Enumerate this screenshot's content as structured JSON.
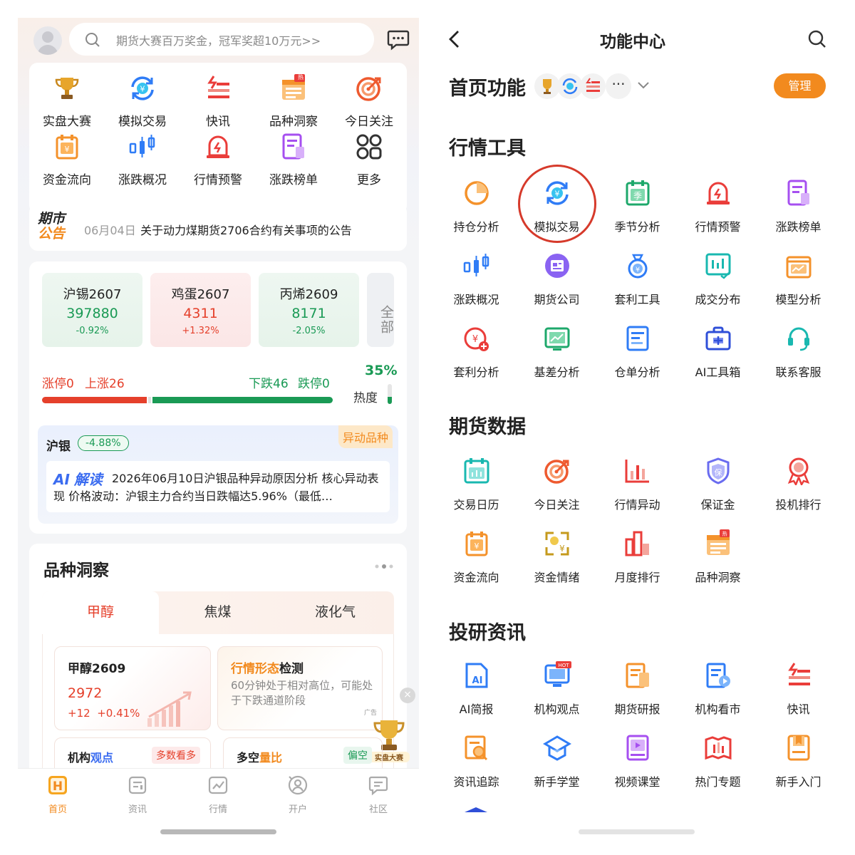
{
  "left": {
    "search_placeholder": "期货大赛百万奖金，冠军奖超10万元>>",
    "grid": [
      {
        "label": "实盘大赛",
        "icon": "trophy-icon"
      },
      {
        "label": "模拟交易",
        "icon": "simulated-trade-icon"
      },
      {
        "label": "快讯",
        "icon": "flash-news-icon"
      },
      {
        "label": "品种洞察",
        "icon": "variety-insight-icon"
      },
      {
        "label": "今日关注",
        "icon": "target-icon"
      },
      {
        "label": "资金流向",
        "icon": "fund-flow-icon"
      },
      {
        "label": "涨跌概况",
        "icon": "candlestick-icon"
      },
      {
        "label": "行情预警",
        "icon": "alarm-icon"
      },
      {
        "label": "涨跌榜单",
        "icon": "ranking-list-icon"
      },
      {
        "label": "更多",
        "icon": "more-grid-icon"
      }
    ],
    "hot_badge": "热",
    "notice": {
      "badge_line1": "期市",
      "badge_line2": "公告",
      "date": "06月04日",
      "text": "关于动力煤期货2706合约有关事项的公告"
    },
    "quotes": [
      {
        "name": "沪锡2607",
        "price": "397880",
        "change": "-0.92%",
        "dir": "down"
      },
      {
        "name": "鸡蛋2607",
        "price": "4311",
        "change": "+1.32%",
        "dir": "up"
      },
      {
        "name": "丙烯2609",
        "price": "8171",
        "change": "-2.05%",
        "dir": "down"
      }
    ],
    "all_label": "全部",
    "breadth": {
      "limit_up": "涨停0",
      "up": "上涨26",
      "down": "下跌46",
      "limit_down": "跌停0",
      "heat_pct": "35%",
      "heat_label": "热度",
      "heat_value": 0.35,
      "up_fraction": 0.36,
      "down_fraction": 0.62
    },
    "anomaly": {
      "name": "沪银",
      "change": "-4.88%",
      "tag": "异动品种",
      "ai_prefix": "AI",
      "ai_label": "解读",
      "text": "2026年06月10日沪银品种异动原因分析 核心异动表现 价格波动：沪银主力合约当日跌幅达5.96%（最低…"
    },
    "insight": {
      "title": "品种洞察",
      "tabs": [
        "甲醇",
        "焦煤",
        "液化气"
      ],
      "card1": {
        "name": "甲醇2609",
        "price": "2972",
        "change": "+12  +0.41%"
      },
      "card2": {
        "title_a": "行情形态",
        "title_b": "检测",
        "text": "60分钟处于相对高位，可能处于下跌通道阶段"
      },
      "card3": {
        "title_a": "机构",
        "title_b": "观点",
        "tag": "多数看多"
      },
      "card4": {
        "title_a": "多空",
        "title_b": "量比",
        "tag": "偏空"
      },
      "ad_label": "广告",
      "trophy_label": "实盘大赛"
    },
    "tabbar": [
      {
        "label": "首页",
        "icon": "home-icon"
      },
      {
        "label": "资讯",
        "icon": "news-icon"
      },
      {
        "label": "行情",
        "icon": "market-chart-icon"
      },
      {
        "label": "开户",
        "icon": "open-account-icon"
      },
      {
        "label": "社区",
        "icon": "community-icon"
      }
    ]
  },
  "right": {
    "title": "功能中心",
    "home_functions": "首页功能",
    "manage": "管理",
    "sections": [
      {
        "title": "行情工具",
        "items": [
          "持仓分析",
          "模拟交易",
          "季节分析",
          "行情预警",
          "涨跌榜单",
          "涨跌概况",
          "期货公司",
          "套利工具",
          "成交分布",
          "模型分析",
          "套利分析",
          "基差分析",
          "仓单分析",
          "AI工具箱",
          "联系客服"
        ]
      },
      {
        "title": "期货数据",
        "items": [
          "交易日历",
          "今日关注",
          "行情异动",
          "保证金",
          "投机排行",
          "资金流向",
          "资金情绪",
          "月度排行",
          "品种洞察"
        ]
      },
      {
        "title": "投研资讯",
        "items": [
          "AI简报",
          "机构观点",
          "期货研报",
          "机构看市",
          "快讯",
          "资讯追踪",
          "新手学堂",
          "视频课堂",
          "热门专题",
          "新手入门"
        ]
      }
    ],
    "hot_tag": "HOT"
  },
  "colors": {
    "accent": "#f28a1e",
    "red": "#e5402b",
    "green": "#1a9a55",
    "blue": "#2f7cf6"
  }
}
